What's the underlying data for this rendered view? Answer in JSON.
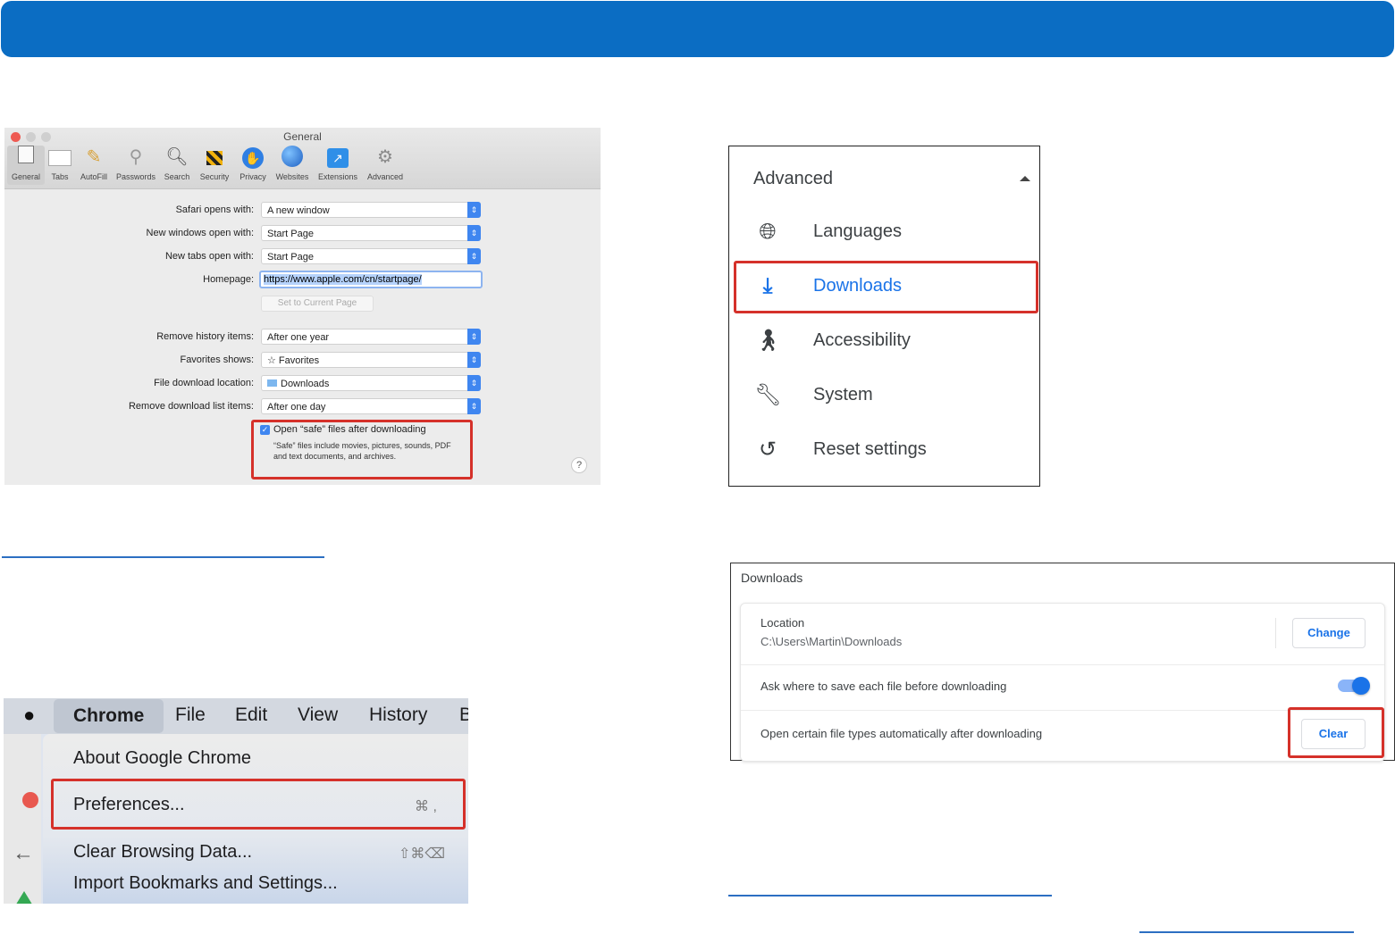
{
  "safari": {
    "window_title": "General",
    "tabs": [
      "General",
      "Tabs",
      "AutoFill",
      "Passwords",
      "Search",
      "Security",
      "Privacy",
      "Websites",
      "Extensions",
      "Advanced"
    ],
    "fields": [
      {
        "label": "Safari opens with:",
        "value": "A new window"
      },
      {
        "label": "New windows open with:",
        "value": "Start Page"
      },
      {
        "label": "New tabs open with:",
        "value": "Start Page"
      }
    ],
    "homepage_label": "Homepage:",
    "homepage_value": "https://www.apple.com/cn/startpage/",
    "set_current_label": "Set to Current Page",
    "fields2": [
      {
        "label": "Remove history items:",
        "value": "After one year"
      },
      {
        "label": "Favorites shows:",
        "value": "☆ Favorites"
      },
      {
        "label": "File download location:",
        "value": "Downloads"
      },
      {
        "label": "Remove download list items:",
        "value": "After one day"
      }
    ],
    "checkbox_label": "Open “safe” files after downloading",
    "checkbox_note": "“Safe” files include movies, pictures, sounds, PDF and text documents, and archives.",
    "help": "?"
  },
  "advanced": {
    "header": "Advanced",
    "items": [
      {
        "label": "Languages",
        "icon": "globe-icon"
      },
      {
        "label": "Downloads",
        "icon": "download-icon"
      },
      {
        "label": "Accessibility",
        "icon": "accessibility-icon"
      },
      {
        "label": "System",
        "icon": "wrench-icon"
      },
      {
        "label": "Reset settings",
        "icon": "history-icon"
      }
    ]
  },
  "downloads": {
    "title": "Downloads",
    "location_label": "Location",
    "location_value": "C:\\Users\\Martin\\Downloads",
    "change_label": "Change",
    "ask_label": "Ask where to save each file before downloading",
    "ask_enabled": true,
    "open_label": "Open certain file types automatically after downloading",
    "clear_label": "Clear"
  },
  "menu": {
    "bar": [
      "Chrome",
      "File",
      "Edit",
      "View",
      "History",
      "B"
    ],
    "items": [
      {
        "label": "About Google Chrome",
        "shortcut": ""
      },
      {
        "label": "Preferences...",
        "shortcut": "⌘ ,"
      },
      {
        "label": "Clear Browsing Data...",
        "shortcut": "⇧⌘⌫"
      },
      {
        "label": "Import Bookmarks and Settings...",
        "shortcut": ""
      }
    ]
  },
  "colors": {
    "banner": "#0b6dc3",
    "highlight": "#d5312a",
    "accent": "#1a73e8"
  }
}
